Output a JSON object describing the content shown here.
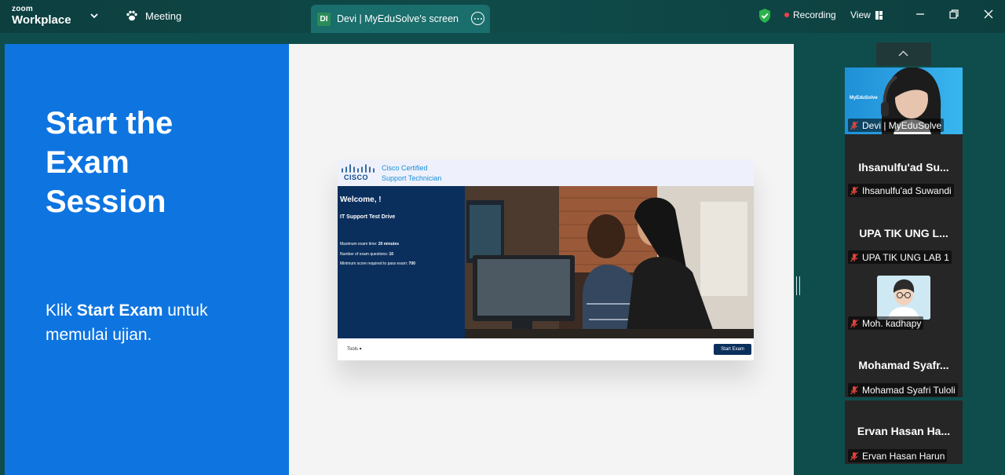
{
  "app": {
    "brand_top": "zoom",
    "brand_bottom": "Workplace"
  },
  "meeting_tab": {
    "label": "Meeting"
  },
  "share_tab": {
    "initials": "DI",
    "title": "Devi | MyEduSolve's screen"
  },
  "status": {
    "recording_label": "Recording",
    "view_label": "View"
  },
  "slide": {
    "title": "Start the\nExam\nSession",
    "instruction_pre": "Klik ",
    "instruction_bold": "Start Exam",
    "instruction_post": " untuk memulai ujian."
  },
  "exam": {
    "brand": "CISCO",
    "cert_title": "Cisco Certified\nSupport Technician",
    "welcome": "Welcome, !",
    "test_name": "IT Support Test Drive",
    "rules": [
      {
        "label": "Maximum exam time: ",
        "value": "20 minutes"
      },
      {
        "label": "Number of exam questions: ",
        "value": "10"
      },
      {
        "label": "Minimum score required to pass exam: ",
        "value": "700"
      }
    ],
    "tools_label": "Tools ▾",
    "start_button": "Start Exam"
  },
  "participants": [
    {
      "display": "",
      "tag": "Devi | MyEduSolve",
      "video": true,
      "logo_text": "MyEduSolve"
    },
    {
      "display": "Ihsanulfu'ad  Su...",
      "tag": "Ihsanulfu'ad Suwandi"
    },
    {
      "display": "UPA TIK UNG L...",
      "tag": "UPA TIK UNG LAB 1"
    },
    {
      "display": "",
      "tag": "Moh. kadhapy",
      "avatar": true
    },
    {
      "display": "Mohamad  Syafr...",
      "tag": "Mohamad Syafri Tuloli"
    },
    {
      "display": "Ervan Hasan  Ha...",
      "tag": "Ervan Hasan Harun"
    }
  ],
  "colors": {
    "slide_blue": "#0e74e0",
    "exam_navy": "#0b2f5c",
    "meeting_bg": "#0f4d4d",
    "mic_muted": "#e0443a"
  }
}
